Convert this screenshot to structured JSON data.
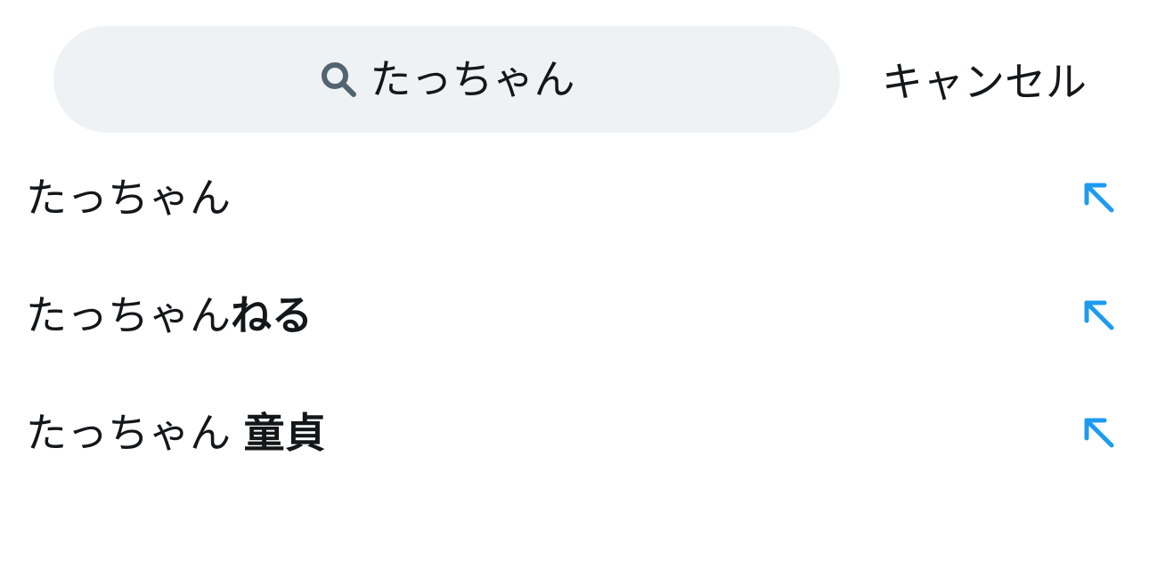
{
  "search": {
    "query": "たっちゃん",
    "icon": "search-icon"
  },
  "cancel_label": "キャンセル",
  "accent_color": "#1d9bf0",
  "suggestions": [
    {
      "prefix": "たっちゃん",
      "completion": "",
      "icon": "arrow-up-left-icon"
    },
    {
      "prefix": "たっちゃん",
      "completion": "ねる",
      "icon": "arrow-up-left-icon"
    },
    {
      "prefix": "たっちゃん ",
      "completion": "童貞",
      "icon": "arrow-up-left-icon"
    }
  ]
}
